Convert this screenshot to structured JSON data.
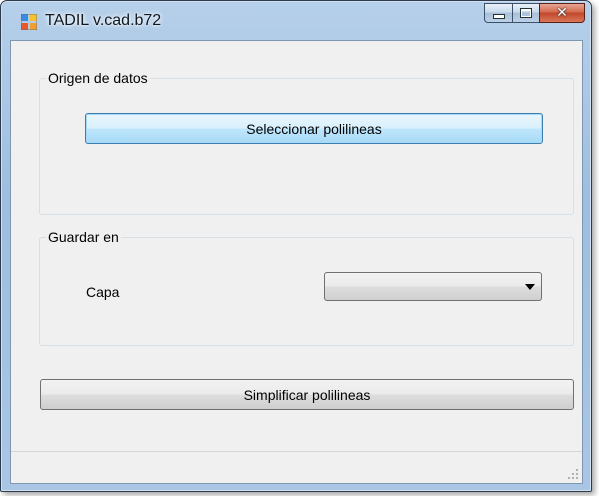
{
  "window": {
    "title": "TADIL v.cad.b72",
    "icons": {
      "app": "app-icon",
      "minimize": "minimize-icon",
      "maximize": "maximize-icon",
      "close": "close-icon"
    }
  },
  "data_source_group": {
    "label": "Origen de datos",
    "select_polylines_button": "Seleccionar polilineas"
  },
  "save_group": {
    "label": "Guardar en",
    "layer_label": "Capa",
    "layer_value": ""
  },
  "simplify_button": "Simplificar polilineas",
  "colors": {
    "default_button_border": "#3c7fb1",
    "close_button": "#c2472a",
    "client_background": "#f0f0f0"
  }
}
